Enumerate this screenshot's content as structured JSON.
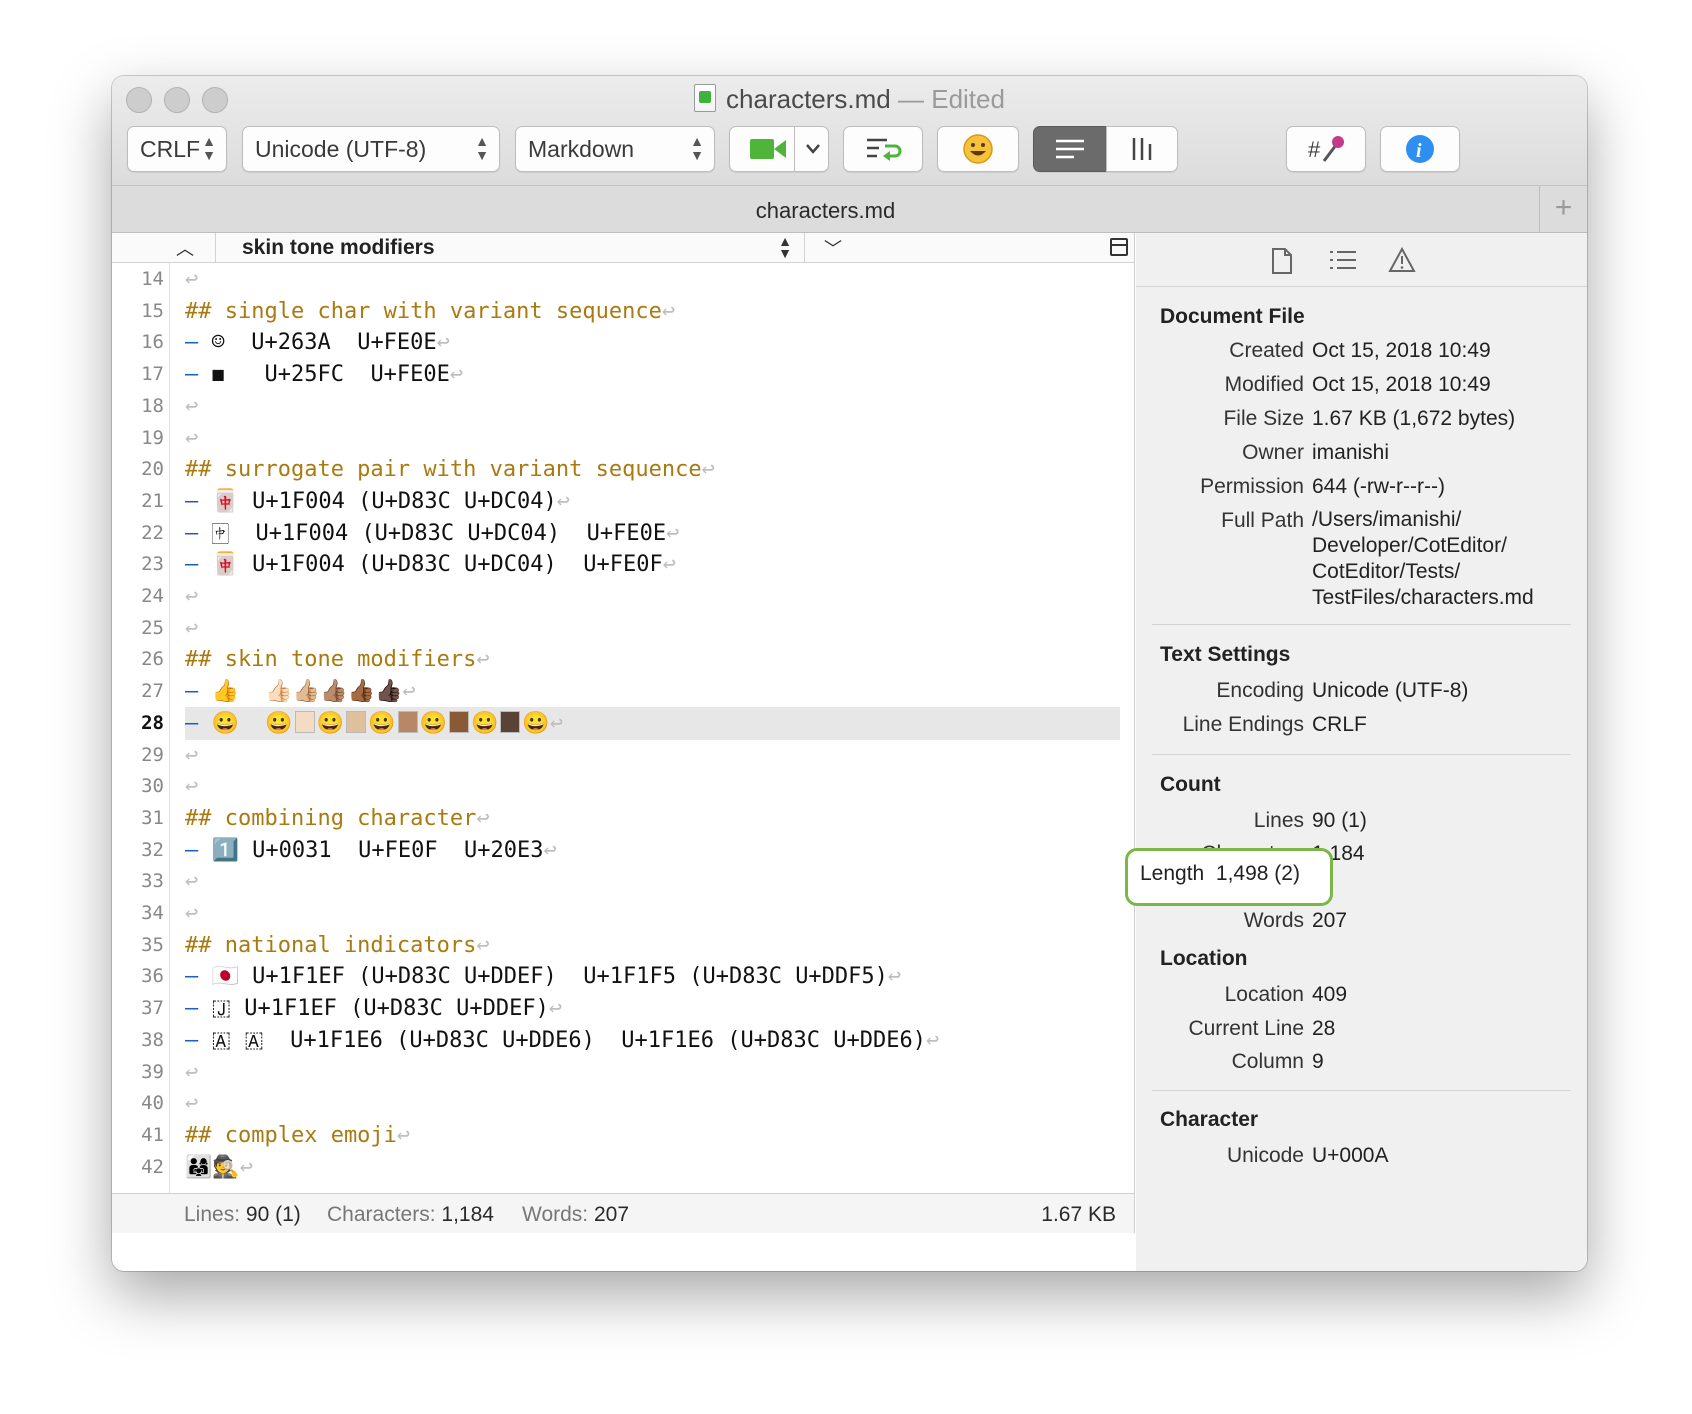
{
  "window": {
    "title": "characters.md",
    "edited": "— Edited"
  },
  "toolbar": {
    "line_ending": "CRLF",
    "encoding": "Unicode (UTF-8)",
    "syntax": "Markdown"
  },
  "tabbar": {
    "tab_label": "characters.md",
    "add_label": "+"
  },
  "navigation": {
    "outline_label": "skin tone modifiers"
  },
  "editor": {
    "current_line": 28,
    "lines": [
      {
        "n": "14",
        "heading": "",
        "body": ""
      },
      {
        "n": "15",
        "heading": "## single char with variant sequence",
        "body": ""
      },
      {
        "n": "16",
        "heading": "",
        "body": "☺  U+263A  U+FE0E"
      },
      {
        "n": "17",
        "heading": "",
        "body": "◼︎   U+25FC  U+FE0E"
      },
      {
        "n": "18",
        "heading": "",
        "body": ""
      },
      {
        "n": "19",
        "heading": "",
        "body": ""
      },
      {
        "n": "20",
        "heading": "## surrogate pair with variant sequence",
        "body": ""
      },
      {
        "n": "21",
        "heading": "",
        "body": "🀄 U+1F004 (U+D83C U+DC04)"
      },
      {
        "n": "22",
        "heading": "",
        "body": "🀄︎  U+1F004 (U+D83C U+DC04)  U+FE0E"
      },
      {
        "n": "23",
        "heading": "",
        "body": "🀄️ U+1F004 (U+D83C U+DC04)  U+FE0F"
      },
      {
        "n": "24",
        "heading": "",
        "body": ""
      },
      {
        "n": "25",
        "heading": "",
        "body": ""
      },
      {
        "n": "26",
        "heading": "## skin tone modifiers",
        "body": ""
      },
      {
        "n": "27",
        "heading": "",
        "body": "👍  👍🏻👍🏼👍🏽👍🏾👍🏿"
      },
      {
        "n": "28",
        "heading": "",
        "body": "😀  😀",
        "swatches": [
          "#f4dcc4",
          "#dfc09c",
          "#b88866",
          "#8a5a36",
          "#5a4236"
        ]
      },
      {
        "n": "29",
        "heading": "",
        "body": ""
      },
      {
        "n": "30",
        "heading": "",
        "body": ""
      },
      {
        "n": "31",
        "heading": "## combining character",
        "body": ""
      },
      {
        "n": "32",
        "heading": "",
        "body": "1️⃣ U+0031  U+FE0F  U+20E3"
      },
      {
        "n": "33",
        "heading": "",
        "body": ""
      },
      {
        "n": "34",
        "heading": "",
        "body": ""
      },
      {
        "n": "35",
        "heading": "## national indicators",
        "body": ""
      },
      {
        "n": "36",
        "heading": "",
        "body": "🇯🇵 U+1F1EF (U+D83C U+DDEF)  U+1F1F5 (U+D83C U+DDF5)"
      },
      {
        "n": "37",
        "heading": "",
        "body": "🇯 U+1F1EF (U+D83C U+DDEF)"
      },
      {
        "n": "38",
        "heading": "",
        "body": "🇦 🇦  U+1F1E6 (U+D83C U+DDE6)  U+1F1E6 (U+D83C U+DDE6)"
      },
      {
        "n": "39",
        "heading": "",
        "body": ""
      },
      {
        "n": "40",
        "heading": "",
        "body": ""
      },
      {
        "n": "41",
        "heading": "## complex emoji",
        "body": ""
      },
      {
        "n": "42",
        "heading": "",
        "body": "👨‍👩‍👧🕵️"
      }
    ]
  },
  "statusbar": {
    "lines_label": "Lines:",
    "lines_value": "90 (1)",
    "chars_label": "Characters:",
    "chars_value": "1,184",
    "words_label": "Words:",
    "words_value": "207",
    "size": "1.67 KB"
  },
  "inspector": {
    "document_file": {
      "title": "Document File",
      "created_k": "Created",
      "created_v": "Oct 15, 2018 10:49",
      "modified_k": "Modified",
      "modified_v": "Oct 15, 2018 10:49",
      "size_k": "File Size",
      "size_v": "1.67 KB (1,672 bytes)",
      "owner_k": "Owner",
      "owner_v": "imanishi",
      "perm_k": "Permission",
      "perm_v": "644 (-rw-r--r--)",
      "path_k": "Full Path",
      "path_v": "/Users/imanishi/\nDeveloper/CotEditor/\nCotEditor/Tests/\nTestFiles/characters.md"
    },
    "text_settings": {
      "title": "Text Settings",
      "encoding_k": "Encoding",
      "encoding_v": "Unicode (UTF-8)",
      "endings_k": "Line Endings",
      "endings_v": "CRLF"
    },
    "count": {
      "title": "Count",
      "lines_k": "Lines",
      "lines_v": "90 (1)",
      "chars_k": "Characters",
      "chars_v": "1,184",
      "length_k": "Length",
      "length_v": "1,498 (2)",
      "words_k": "Words",
      "words_v": "207"
    },
    "location": {
      "title": "Location",
      "location_k": "Location",
      "location_v": "409",
      "line_k": "Current Line",
      "line_v": "28",
      "column_k": "Column",
      "column_v": "9"
    },
    "character": {
      "title": "Character",
      "unicode_k": "Unicode",
      "unicode_v": "U+000A"
    }
  },
  "colors": {
    "heading": "#a97a10",
    "list_dash": "#1d5fbf",
    "callout": "#7ab648",
    "selected_button": "#6b6b6b"
  },
  "icons": [
    "document-icon",
    "toc-icon",
    "warning-icon",
    "info-icon",
    "emoji-icon",
    "wrap-icon",
    "split-icon",
    "video-icon",
    "color-picker-icon"
  ]
}
